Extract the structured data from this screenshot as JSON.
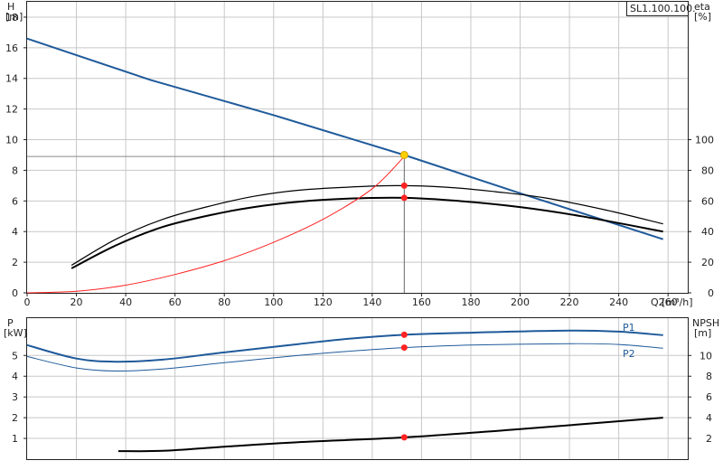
{
  "chart_data": [
    {
      "type": "line",
      "name": "pump-performance",
      "label_box": "SL1.100.100.",
      "xlabel": "Q [m³/h]",
      "ylabel_left": [
        "H",
        "[m]"
      ],
      "ylabel_right": [
        "eta",
        "[%]"
      ],
      "xlim": [
        0,
        268
      ],
      "ylim": [
        0,
        19
      ],
      "ylim_right": [
        0,
        190
      ],
      "xticks": [
        0,
        20,
        40,
        60,
        80,
        100,
        120,
        140,
        160,
        180,
        200,
        220,
        240,
        260
      ],
      "yticks": [
        0,
        2,
        4,
        6,
        8,
        10,
        12,
        14,
        16,
        18
      ],
      "yticks_right": [
        0,
        20,
        40,
        60,
        80,
        100
      ],
      "grid": true,
      "series": [
        {
          "color": "#1f5a9a",
          "width": 2,
          "axis": "left",
          "x": [
            0,
            50,
            100,
            153,
            200,
            258
          ],
          "y": [
            16.6,
            13.9,
            11.6,
            9.0,
            6.5,
            3.5
          ]
        },
        {
          "color": "#000000",
          "width": 1.2,
          "axis": "left",
          "x": [
            18,
            36,
            55,
            75,
            92,
            110,
            130,
            150,
            170,
            190,
            210,
            235,
            258
          ],
          "y": [
            1.8,
            3.5,
            4.8,
            5.7,
            6.3,
            6.7,
            6.9,
            7.0,
            6.9,
            6.6,
            6.2,
            5.4,
            4.5
          ]
        },
        {
          "color": "#000000",
          "width": 2,
          "axis": "left",
          "x": [
            18,
            36,
            55,
            75,
            92,
            110,
            130,
            153,
            175,
            200,
            225,
            258
          ],
          "y": [
            1.6,
            3.1,
            4.3,
            5.1,
            5.6,
            5.95,
            6.15,
            6.2,
            6.0,
            5.6,
            5.0,
            4.0
          ]
        },
        {
          "color": "#ff2222",
          "width": 1,
          "axis": "left",
          "x": [
            0,
            20,
            40,
            60,
            80,
            100,
            120,
            140,
            153
          ],
          "y": [
            0,
            0.1,
            0.5,
            1.2,
            2.1,
            3.3,
            4.8,
            6.8,
            8.9
          ]
        }
      ],
      "refline": {
        "x": 153,
        "y": 8.9
      },
      "points": [
        {
          "x": 153,
          "y": 9.0,
          "color": "#ffd000",
          "stroke": "#d4a000",
          "r": 4
        },
        {
          "x": 153,
          "y": 7.0,
          "color": "#ff2222",
          "stroke": "#ff2222",
          "r": 3
        },
        {
          "x": 153,
          "y": 6.2,
          "color": "#ff2222",
          "stroke": "#ff2222",
          "r": 3
        }
      ]
    },
    {
      "type": "line",
      "name": "power-npsh",
      "ylabel_left": [
        "P",
        "[kW]"
      ],
      "ylabel_right": [
        "NPSH",
        "[m]"
      ],
      "xlim": [
        0,
        268
      ],
      "ylim": [
        0,
        6.8
      ],
      "ylim_right": [
        0,
        13.6
      ],
      "yticks": [
        1,
        2,
        3,
        4,
        5
      ],
      "yticks_right": [
        2,
        4,
        6,
        8,
        10
      ],
      "xgrid": [
        20,
        40,
        60,
        80,
        100,
        120,
        140,
        160,
        180,
        200,
        220,
        240,
        260
      ],
      "grid": true,
      "series": [
        {
          "name": "P1",
          "color": "#1f5a9a",
          "width": 2,
          "axis": "left",
          "x": [
            0,
            20,
            36,
            55,
            80,
            110,
            130,
            153,
            180,
            220,
            240,
            258
          ],
          "y": [
            5.5,
            4.85,
            4.7,
            4.8,
            5.15,
            5.55,
            5.8,
            6.0,
            6.1,
            6.2,
            6.15,
            5.98
          ]
        },
        {
          "name": "P2",
          "color": "#1f5a9a",
          "width": 1,
          "axis": "left",
          "x": [
            0,
            20,
            36,
            55,
            80,
            110,
            130,
            153,
            180,
            220,
            240,
            258
          ],
          "y": [
            4.95,
            4.4,
            4.25,
            4.35,
            4.65,
            5.0,
            5.2,
            5.38,
            5.5,
            5.57,
            5.53,
            5.35
          ]
        },
        {
          "color": "#000000",
          "width": 2,
          "axis": "right",
          "x": [
            37,
            55,
            80,
            110,
            153,
            200,
            258
          ],
          "y": [
            0.78,
            0.8,
            1.2,
            1.64,
            2.1,
            2.9,
            4.0
          ]
        }
      ],
      "points": [
        {
          "x": 153,
          "y": 6.0,
          "color": "#ff2222",
          "stroke": "#ff2222",
          "r": 3
        },
        {
          "x": 153,
          "y": 5.38,
          "color": "#ff2222",
          "stroke": "#ff2222",
          "r": 3
        },
        {
          "x": 153,
          "y": 1.05,
          "color": "#ff2222",
          "stroke": "#ff2222",
          "r": 3
        }
      ]
    }
  ]
}
